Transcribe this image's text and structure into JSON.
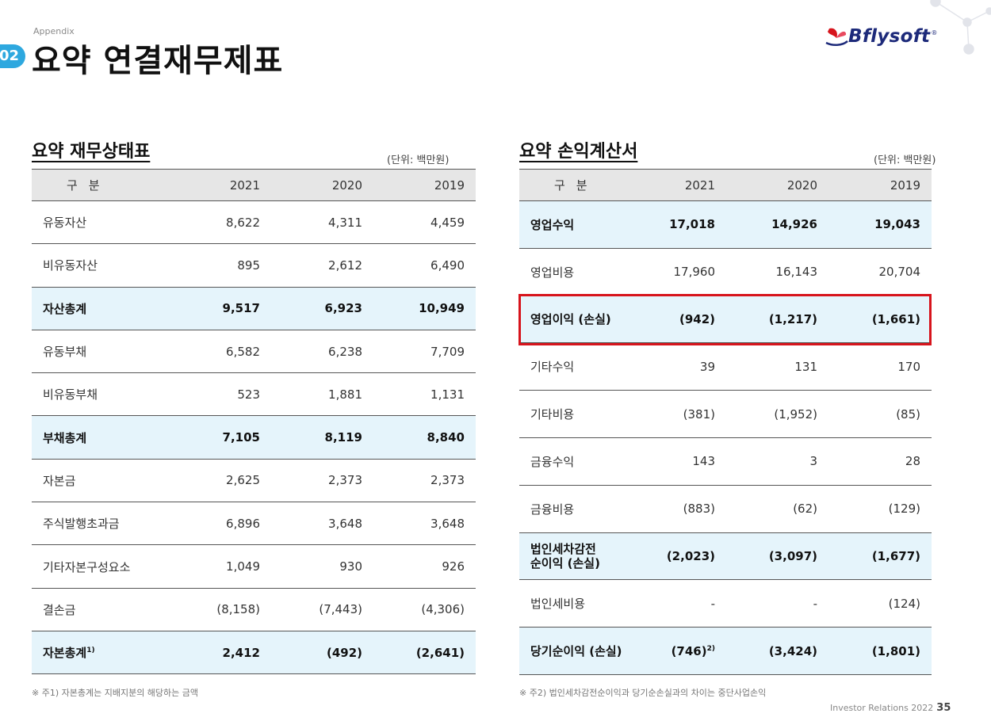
{
  "header": {
    "badge": "02",
    "appendix": "Appendix",
    "title": "요약 연결재무제표",
    "logo_text": "Bflysoft",
    "logo_reg": "®"
  },
  "balance_sheet": {
    "title": "요약 재무상태표",
    "unit": "(단위: 백만원)",
    "columns": [
      "구분",
      "2021",
      "2020",
      "2019"
    ],
    "rows": [
      {
        "label": "유동자산",
        "sup": "",
        "values": [
          "8,622",
          "4,311",
          "4,459"
        ],
        "highlight": false
      },
      {
        "label": "비유동자산",
        "sup": "",
        "values": [
          "895",
          "2,612",
          "6,490"
        ],
        "highlight": false
      },
      {
        "label": "자산총계",
        "sup": "",
        "values": [
          "9,517",
          "6,923",
          "10,949"
        ],
        "highlight": true
      },
      {
        "label": "유동부채",
        "sup": "",
        "values": [
          "6,582",
          "6,238",
          "7,709"
        ],
        "highlight": false
      },
      {
        "label": "비유동부채",
        "sup": "",
        "values": [
          "523",
          "1,881",
          "1,131"
        ],
        "highlight": false
      },
      {
        "label": "부채총계",
        "sup": "",
        "values": [
          "7,105",
          "8,119",
          "8,840"
        ],
        "highlight": true
      },
      {
        "label": "자본금",
        "sup": "",
        "values": [
          "2,625",
          "2,373",
          "2,373"
        ],
        "highlight": false
      },
      {
        "label": "주식발행초과금",
        "sup": "",
        "values": [
          "6,896",
          "3,648",
          "3,648"
        ],
        "highlight": false
      },
      {
        "label": "기타자본구성요소",
        "sup": "",
        "values": [
          "1,049",
          "930",
          "926"
        ],
        "highlight": false
      },
      {
        "label": "결손금",
        "sup": "",
        "values": [
          "(8,158)",
          "(7,443)",
          "(4,306)"
        ],
        "highlight": false
      },
      {
        "label": "자본총계",
        "sup": "1)",
        "values": [
          "2,412",
          "(492)",
          "(2,641)"
        ],
        "highlight": true
      }
    ],
    "footnote": "※ 주1) 자본총계는 지배지분의 해당하는 금액"
  },
  "income_statement": {
    "title": "요약 손익계산서",
    "unit": "(단위: 백만원)",
    "columns": [
      "구분",
      "2021",
      "2020",
      "2019"
    ],
    "rows": [
      {
        "label": "영업수익",
        "values": [
          "17,018",
          "14,926",
          "19,043"
        ],
        "highlight": true
      },
      {
        "label": "영업비용",
        "values": [
          "17,960",
          "16,143",
          "20,704"
        ],
        "highlight": false
      },
      {
        "label": "영업이익 (손실)",
        "values": [
          "(942)",
          "(1,217)",
          "(1,661)"
        ],
        "highlight": true,
        "boxed": true
      },
      {
        "label": "기타수익",
        "values": [
          "39",
          "131",
          "170"
        ],
        "highlight": false
      },
      {
        "label": "기타비용",
        "values": [
          "(381)",
          "(1,952)",
          "(85)"
        ],
        "highlight": false
      },
      {
        "label": "금융수익",
        "values": [
          "143",
          "3",
          "28"
        ],
        "highlight": false
      },
      {
        "label": "금융비용",
        "values": [
          "(883)",
          "(62)",
          "(129)"
        ],
        "highlight": false
      },
      {
        "label": "법인세차감전 순이익 (손실)",
        "label_line1": "법인세차감전",
        "label_line2": "순이익 (손실)",
        "values": [
          "(2,023)",
          "(3,097)",
          "(1,677)"
        ],
        "highlight": true
      },
      {
        "label": "법인세비용",
        "values": [
          "-",
          "-",
          "(124)"
        ],
        "highlight": false
      },
      {
        "label": "당기순이익 (손실)",
        "values": [
          "(746)",
          "(3,424)",
          "(1,801)"
        ],
        "value_sup": "2)",
        "highlight": true
      }
    ],
    "footnote": "※ 주2) 법인세차감전순이익과 당기순손실과의 차이는 중단사업손익"
  },
  "footer": {
    "text": "Investor Relations 2022",
    "page": "35"
  },
  "colors": {
    "accent_blue": "#2ea8df",
    "highlight_row": "#e5f4fb",
    "header_row": "#e6e6e6",
    "red_box": "#d7141c",
    "logo_navy": "#1d2a7a"
  }
}
